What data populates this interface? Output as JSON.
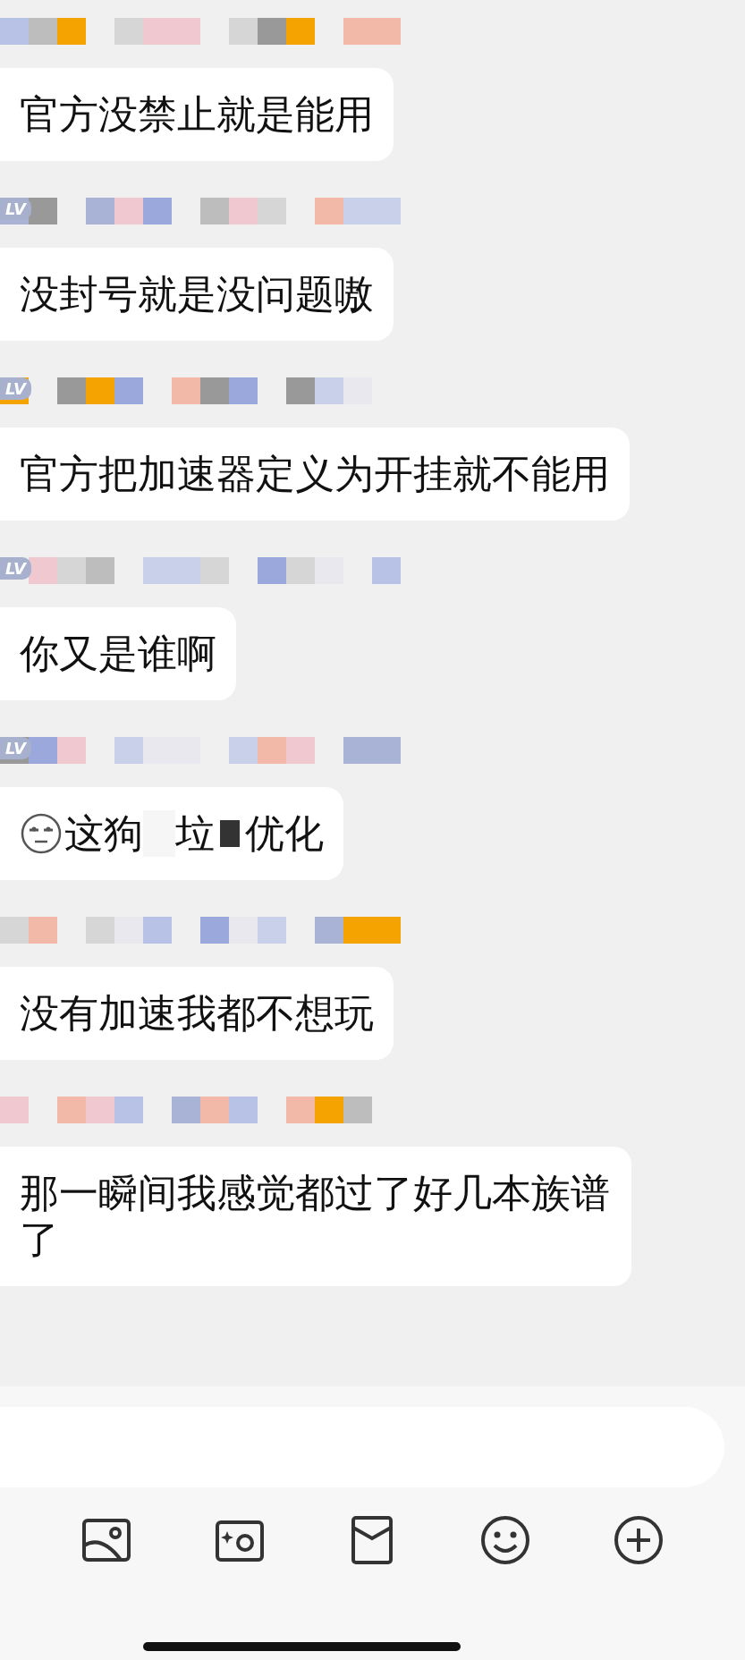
{
  "messages": [
    {
      "parts": [
        {
          "kind": "text",
          "text": "官方没禁止就是能用"
        }
      ]
    },
    {
      "badge": "LV",
      "parts": [
        {
          "kind": "text",
          "text": "没封号就是没问题嗷"
        }
      ]
    },
    {
      "badge": "LV",
      "parts": [
        {
          "kind": "text",
          "text": "官方把加速器定义为开挂就不能用"
        }
      ]
    },
    {
      "badge": "LV",
      "parts": [
        {
          "kind": "text",
          "text": "你又是谁啊"
        }
      ]
    },
    {
      "badge": "LV",
      "parts": [
        {
          "kind": "emoji"
        },
        {
          "kind": "text",
          "text": "这狗"
        },
        {
          "kind": "blur"
        },
        {
          "kind": "text",
          "text": "垃"
        },
        {
          "kind": "blackout"
        },
        {
          "kind": "text",
          "text": "优化"
        }
      ]
    },
    {
      "parts": [
        {
          "kind": "text",
          "text": "没有加速我都不想玩"
        }
      ]
    },
    {
      "parts": [
        {
          "kind": "text",
          "text": "那一瞬间我感觉都过了好几本族谱了"
        }
      ]
    }
  ],
  "toolbar": [
    {
      "kind": "image"
    },
    {
      "kind": "camera"
    },
    {
      "kind": "pouch"
    },
    {
      "kind": "emoji"
    },
    {
      "kind": "plus"
    }
  ]
}
